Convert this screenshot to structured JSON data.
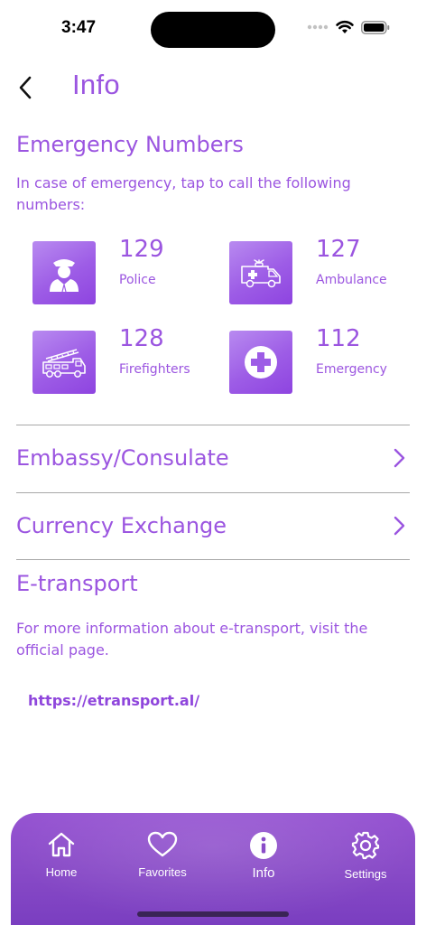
{
  "status_bar": {
    "time": "3:47"
  },
  "header": {
    "title": "Info"
  },
  "emergency": {
    "title": "Emergency Numbers",
    "description": "In case of emergency, tap to call the following numbers:",
    "items": [
      {
        "number": "129",
        "label": "Police",
        "icon": "police-officer-icon"
      },
      {
        "number": "127",
        "label": "Ambulance",
        "icon": "ambulance-icon"
      },
      {
        "number": "128",
        "label": "Firefighters",
        "icon": "fire-truck-icon"
      },
      {
        "number": "112",
        "label": "Emergency",
        "icon": "medical-cross-icon"
      }
    ]
  },
  "links": {
    "embassy": "Embassy/Consulate",
    "currency": "Currency Exchange"
  },
  "etransport": {
    "title": "E-transport",
    "description": "For more information about e-transport, visit the official page.",
    "url": "https://etransport.al/"
  },
  "tab_bar": {
    "tabs": [
      {
        "label": "Home",
        "icon": "home-icon"
      },
      {
        "label": "Favorites",
        "icon": "heart-icon"
      },
      {
        "label": "Info",
        "icon": "info-icon",
        "active": true
      },
      {
        "label": "Settings",
        "icon": "gear-icon"
      }
    ]
  },
  "colors": {
    "accent": "#9b55e0",
    "tab_bar": "#8a4cc8",
    "divider": "#a8a8a8"
  }
}
